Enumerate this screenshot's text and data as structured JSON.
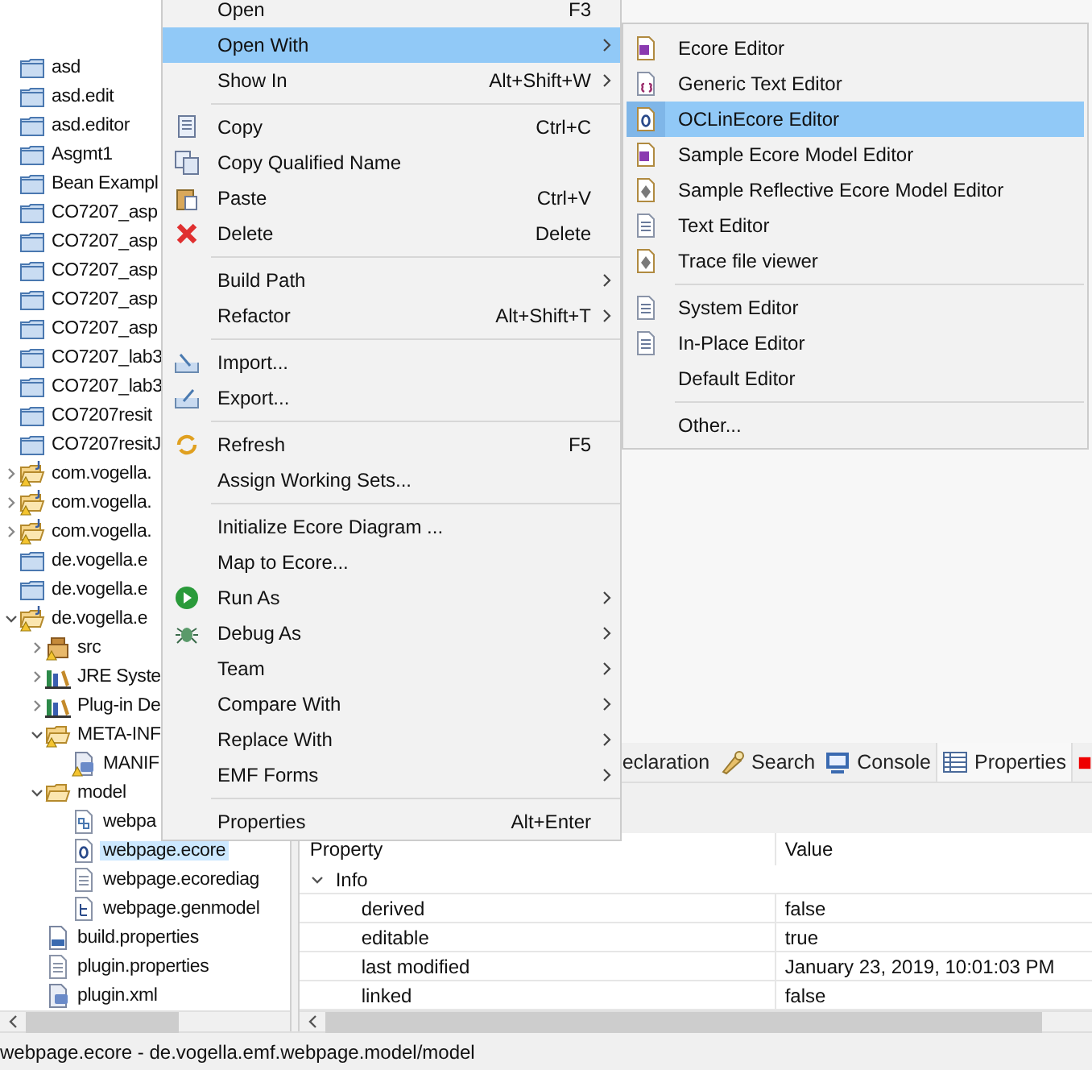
{
  "tree": {
    "items": [
      {
        "label": "asd",
        "kind": "project",
        "warning": false
      },
      {
        "label": "asd.edit",
        "kind": "project",
        "warning": false
      },
      {
        "label": "asd.editor",
        "kind": "project",
        "warning": false
      },
      {
        "label": "Asgmt1",
        "kind": "project",
        "warning": false
      },
      {
        "label": "Bean Exampl",
        "kind": "project",
        "warning": false
      },
      {
        "label": "CO7207_asp",
        "kind": "project",
        "warning": false
      },
      {
        "label": "CO7207_asp",
        "kind": "project",
        "warning": false
      },
      {
        "label": "CO7207_asp",
        "kind": "project",
        "warning": false
      },
      {
        "label": "CO7207_asp",
        "kind": "project",
        "warning": false
      },
      {
        "label": "CO7207_asp",
        "kind": "project",
        "warning": false
      },
      {
        "label": "CO7207_lab3",
        "kind": "project",
        "warning": false
      },
      {
        "label": "CO7207_lab3",
        "kind": "project",
        "warning": false
      },
      {
        "label": "CO7207resit",
        "kind": "project",
        "warning": false
      },
      {
        "label": "CO7207resitJ",
        "kind": "project",
        "warning": false
      },
      {
        "label": "com.vogella.",
        "kind": "plugin",
        "warning": true,
        "expanded": false
      },
      {
        "label": "com.vogella.",
        "kind": "plugin",
        "warning": true,
        "expanded": false
      },
      {
        "label": "com.vogella.",
        "kind": "plugin",
        "warning": true,
        "expanded": false
      },
      {
        "label": "de.vogella.e",
        "kind": "project",
        "warning": false
      },
      {
        "label": "de.vogella.e",
        "kind": "project",
        "warning": false
      },
      {
        "label": "de.vogella.e",
        "kind": "plugin",
        "warning": true,
        "expanded": true,
        "children": [
          {
            "label": "src",
            "kind": "package",
            "warning": true,
            "expanded": false
          },
          {
            "label": "JRE Syste",
            "kind": "library",
            "warning": false,
            "expanded": false
          },
          {
            "label": "Plug-in De",
            "kind": "library",
            "warning": false,
            "expanded": false
          },
          {
            "label": "META-INF",
            "kind": "folder",
            "warning": true,
            "expanded": true,
            "children": [
              {
                "label": "MANIF",
                "kind": "manifest",
                "warning": true
              }
            ]
          },
          {
            "label": "model",
            "kind": "folder",
            "warning": false,
            "expanded": true,
            "children": [
              {
                "label": "webpa",
                "kind": "diagram",
                "warning": false,
                "selected": false
              },
              {
                "label": "webpage.ecore",
                "kind": "ecore",
                "warning": false,
                "selected": true
              },
              {
                "label": "webpage.ecorediag",
                "kind": "text",
                "warning": false,
                "selected": false
              },
              {
                "label": "webpage.genmodel",
                "kind": "genmodel",
                "warning": false,
                "selected": false
              }
            ]
          },
          {
            "label": "build.properties",
            "kind": "binary",
            "warning": false
          },
          {
            "label": "plugin.properties",
            "kind": "text",
            "warning": false
          },
          {
            "label": "plugin.xml",
            "kind": "plugin-file",
            "warning": false
          }
        ]
      }
    ]
  },
  "context_menu": {
    "items": [
      {
        "kind": "item",
        "label": "Open",
        "shortcut": "F3",
        "submenu": false,
        "selected": false
      },
      {
        "kind": "item",
        "label": "Open With",
        "submenu": true,
        "selected": true
      },
      {
        "kind": "item",
        "label": "Show In",
        "shortcut": "Alt+Shift+W",
        "submenu": true,
        "selected": false
      },
      {
        "kind": "separator"
      },
      {
        "kind": "item",
        "label": "Copy",
        "shortcut": "Ctrl+C",
        "submenu": false,
        "selected": false
      },
      {
        "kind": "item",
        "label": "Copy Qualified Name",
        "submenu": false,
        "selected": false
      },
      {
        "kind": "item",
        "label": "Paste",
        "shortcut": "Ctrl+V",
        "submenu": false,
        "selected": false
      },
      {
        "kind": "item",
        "label": "Delete",
        "shortcut": "Delete",
        "submenu": false,
        "selected": false
      },
      {
        "kind": "separator"
      },
      {
        "kind": "item",
        "label": "Build Path",
        "submenu": true,
        "selected": false
      },
      {
        "kind": "item",
        "label": "Refactor",
        "shortcut": "Alt+Shift+T",
        "submenu": true,
        "selected": false
      },
      {
        "kind": "separator"
      },
      {
        "kind": "item",
        "label": "Import...",
        "submenu": false,
        "selected": false
      },
      {
        "kind": "item",
        "label": "Export...",
        "submenu": false,
        "selected": false
      },
      {
        "kind": "separator"
      },
      {
        "kind": "item",
        "label": "Refresh",
        "shortcut": "F5",
        "submenu": false,
        "selected": false
      },
      {
        "kind": "item",
        "label": "Assign Working Sets...",
        "submenu": false,
        "selected": false
      },
      {
        "kind": "separator"
      },
      {
        "kind": "item",
        "label": "Initialize Ecore Diagram ...",
        "submenu": false,
        "selected": false
      },
      {
        "kind": "item",
        "label": "Map to Ecore...",
        "submenu": false,
        "selected": false
      },
      {
        "kind": "item",
        "label": "Run As",
        "submenu": true,
        "selected": false
      },
      {
        "kind": "item",
        "label": "Debug As",
        "submenu": true,
        "selected": false
      },
      {
        "kind": "item",
        "label": "Team",
        "submenu": true,
        "selected": false
      },
      {
        "kind": "item",
        "label": "Compare With",
        "submenu": true,
        "selected": false
      },
      {
        "kind": "item",
        "label": "Replace With",
        "submenu": true,
        "selected": false
      },
      {
        "kind": "item",
        "label": "EMF Forms",
        "submenu": true,
        "selected": false
      },
      {
        "kind": "separator"
      },
      {
        "kind": "item",
        "label": "Properties",
        "shortcut": "Alt+Enter",
        "submenu": false,
        "selected": false
      }
    ]
  },
  "open_with_menu": {
    "items": [
      {
        "kind": "item",
        "label": "Ecore Editor",
        "selected": false
      },
      {
        "kind": "item",
        "label": "Generic Text Editor",
        "selected": false
      },
      {
        "kind": "item",
        "label": "OCLinEcore Editor",
        "selected": true
      },
      {
        "kind": "item",
        "label": "Sample Ecore Model Editor",
        "selected": false
      },
      {
        "kind": "item",
        "label": "Sample Reflective Ecore Model Editor",
        "selected": false
      },
      {
        "kind": "item",
        "label": "Text Editor",
        "selected": false
      },
      {
        "kind": "item",
        "label": "Trace file viewer",
        "selected": false
      },
      {
        "kind": "separator"
      },
      {
        "kind": "item",
        "label": "System Editor",
        "selected": false
      },
      {
        "kind": "item",
        "label": "In-Place Editor",
        "selected": false
      },
      {
        "kind": "item",
        "label": "Default Editor",
        "selected": false
      },
      {
        "kind": "separator"
      },
      {
        "kind": "item",
        "label": "Other...",
        "selected": false
      }
    ]
  },
  "bottom_panel": {
    "tabs": [
      {
        "label": "eclaration",
        "selected": false
      },
      {
        "label": "Search",
        "selected": false
      },
      {
        "label": "Console",
        "selected": false
      },
      {
        "label": "Properties",
        "selected": true
      }
    ],
    "table": {
      "columns": [
        "Property",
        "Value"
      ],
      "groups": [
        {
          "label": "Info",
          "expanded": true,
          "rows": [
            {
              "property": "derived",
              "value": "false"
            },
            {
              "property": "editable",
              "value": "true"
            },
            {
              "property": "last modified",
              "value": "January 23, 2019, 10:01:03 PM"
            },
            {
              "property": "linked",
              "value": "false"
            }
          ]
        }
      ]
    }
  },
  "status_bar": {
    "text": "webpage.ecore - de.vogella.emf.webpage.model/model"
  }
}
